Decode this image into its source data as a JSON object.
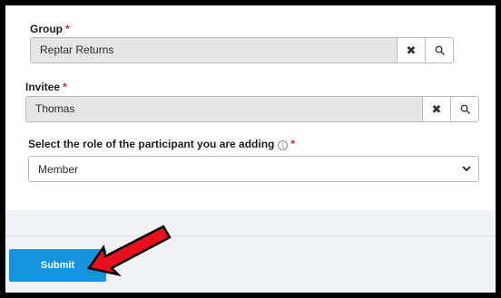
{
  "form": {
    "group": {
      "label": "Group",
      "required_mark": "*",
      "value": "Reptar Returns",
      "clear_icon": "close-icon",
      "search_icon": "search-icon"
    },
    "invitee": {
      "label": "Invitee",
      "required_mark": "*",
      "value": "Thomas",
      "clear_icon": "close-icon",
      "search_icon": "search-icon"
    },
    "role": {
      "label": "Select the role of the participant you are adding",
      "info_glyph": "i",
      "required_mark": "*",
      "value": "Member",
      "chevron_icon": "chevron-down-icon"
    }
  },
  "footer": {
    "submit_label": "Submit"
  },
  "annotation": {
    "arrow_color": "#e8101c",
    "icon": "red-arrow-pointer"
  },
  "colors": {
    "accent": "#1593dd",
    "required": "#e0192f",
    "readonly_bg": "#e6e6e6"
  }
}
